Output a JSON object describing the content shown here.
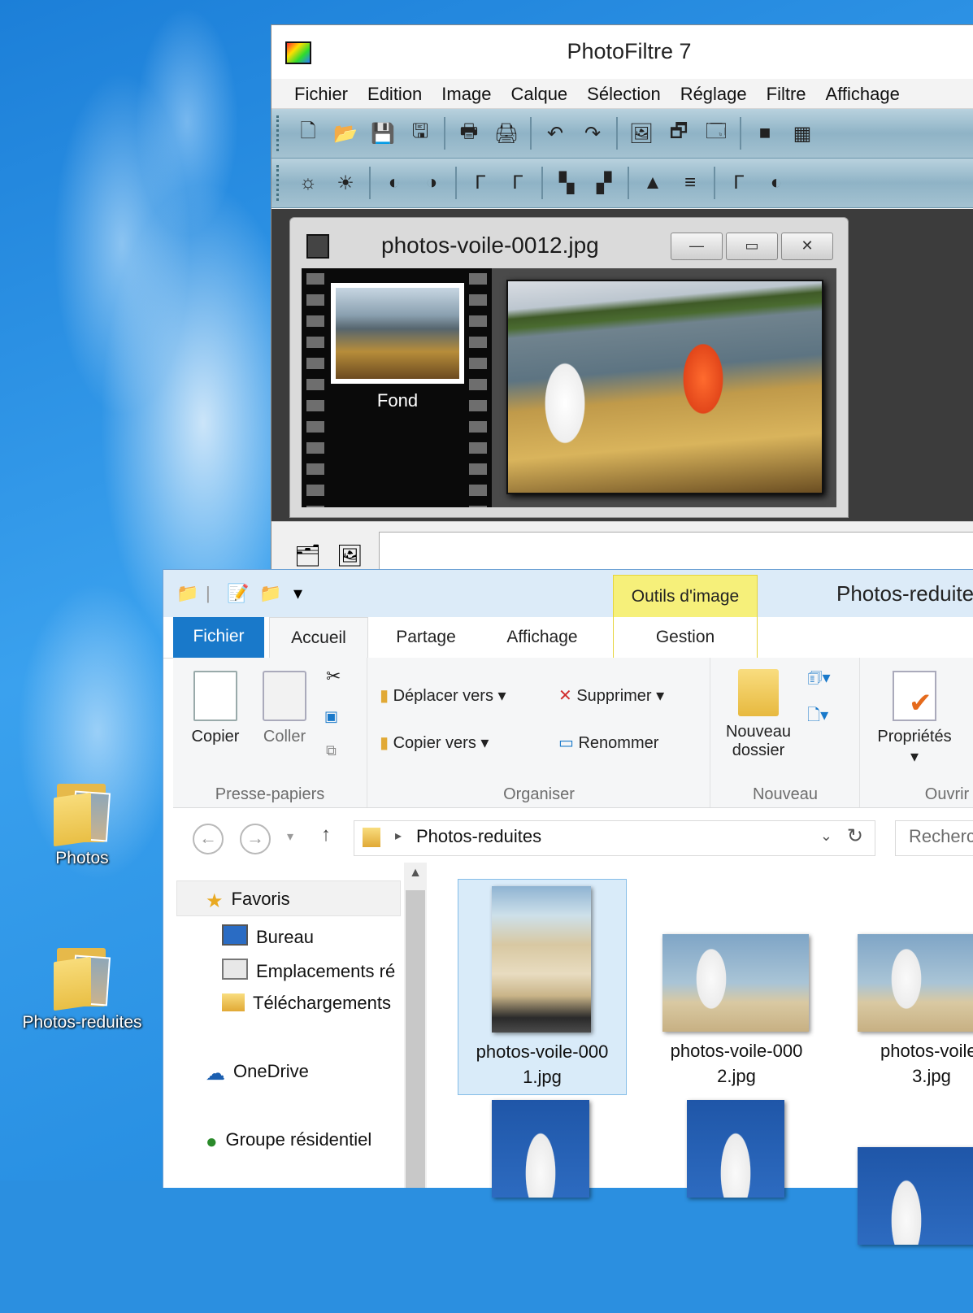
{
  "desktop": {
    "icons": [
      {
        "label": "Photos"
      },
      {
        "label": "Photos-reduites"
      }
    ]
  },
  "photofiltre": {
    "title": "PhotoFiltre 7",
    "menu": [
      "Fichier",
      "Edition",
      "Image",
      "Calque",
      "Sélection",
      "Réglage",
      "Filtre",
      "Affichage"
    ],
    "document": {
      "title": "photos-voile-0012.jpg",
      "layer_label": "Fond",
      "min_glyph": "—",
      "max_glyph": "▭",
      "close_glyph": "✕"
    }
  },
  "explorer": {
    "context_tab": "Outils d'image",
    "window_title": "Photos-reduites",
    "tabs": {
      "file": "Fichier",
      "home": "Accueil",
      "share": "Partage",
      "view": "Affichage",
      "manage": "Gestion"
    },
    "ribbon": {
      "clipboard": {
        "copy": "Copier",
        "paste": "Coller",
        "label": "Presse-papiers"
      },
      "organize": {
        "move_to": "Déplacer vers",
        "copy_to": "Copier vers",
        "delete": "Supprimer",
        "rename": "Renommer",
        "label": "Organiser"
      },
      "new": {
        "new_folder_1": "Nouveau",
        "new_folder_2": "dossier",
        "label": "Nouveau"
      },
      "open": {
        "properties": "Propriétés",
        "label": "Ouvrir"
      }
    },
    "address": {
      "path": "Photos-reduites",
      "search_placeholder": "Recherc"
    },
    "nav": {
      "favorites": "Favoris",
      "desktop": "Bureau",
      "recent": "Emplacements ré",
      "downloads": "Téléchargements",
      "onedrive": "OneDrive",
      "homegroup": "Groupe résidentiel"
    },
    "files": [
      {
        "name_1": "photos-voile-000",
        "name_2": "1.jpg"
      },
      {
        "name_1": "photos-voile-000",
        "name_2": "2.jpg"
      },
      {
        "name_1": "photos-voile-",
        "name_2": "3.jpg"
      }
    ]
  }
}
